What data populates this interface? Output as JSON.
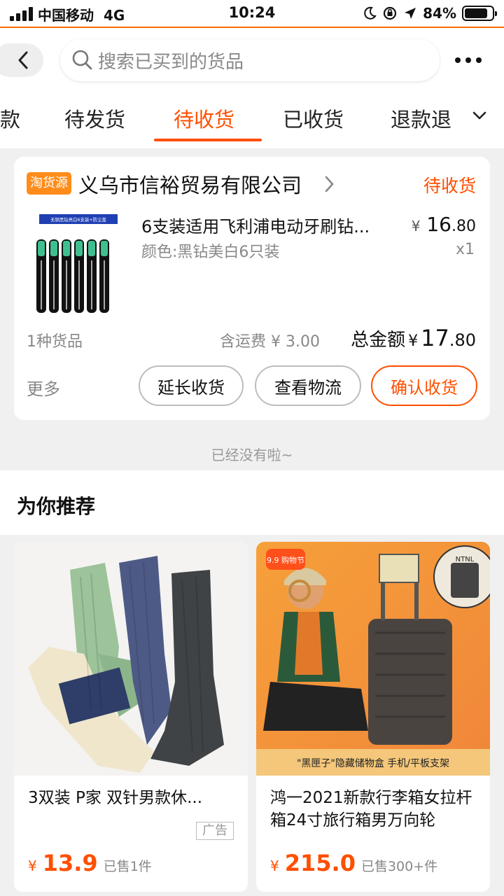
{
  "status_bar": {
    "carrier": "中国移动",
    "network": "4G",
    "time": "10:24",
    "battery": "84%",
    "battery_level": 0.84
  },
  "header": {
    "search_placeholder": "搜索已买到的货品"
  },
  "tabs": [
    {
      "label": "款"
    },
    {
      "label": "待发货"
    },
    {
      "label": "待收货",
      "active": true
    },
    {
      "label": "已收货"
    },
    {
      "label": "退款退"
    }
  ],
  "order": {
    "shop_badge": "淘货源",
    "shop_name": "义乌市信裕贸易有限公司",
    "status": "待收货",
    "product": {
      "title": "6支装适用飞利浦电动牙刷钻...",
      "spec": "颜色:黑钻美白6只装",
      "price_currency": "¥",
      "price_int": "16",
      "price_dec": ".80",
      "quantity": "x1",
      "image_caption": "无铜黑钻亮白6支装+防尘盖"
    },
    "item_count": "1种货品",
    "shipping": "含运费 ¥ 3.00",
    "total_label": "总金额",
    "total_currency": "¥",
    "total_int": "17",
    "total_dec": ".80",
    "more": "更多",
    "buttons": {
      "extend": "延长收货",
      "logistics": "查看物流",
      "confirm": "确认收货"
    }
  },
  "end_text": "已经没有啦~",
  "recommend": {
    "title": "为你推荐",
    "items": [
      {
        "name": "3双装 P家 双针男款休...",
        "ad": "广告",
        "currency": "¥",
        "price": "13.9",
        "sold": "已售1件"
      },
      {
        "name": "鸿一2021新款行李箱女拉杆箱24寸旅行箱男万向轮",
        "currency": "¥",
        "price": "215.0",
        "sold": "已售300+件",
        "image_badge": "9.9 购物节",
        "image_banner": "\"黑匣子\"隐藏储物盒  手机/平板支架",
        "image_logo": "NTNL"
      }
    ]
  },
  "colors": {
    "accent": "#ff4f00",
    "badge": "#ff8c1a"
  }
}
